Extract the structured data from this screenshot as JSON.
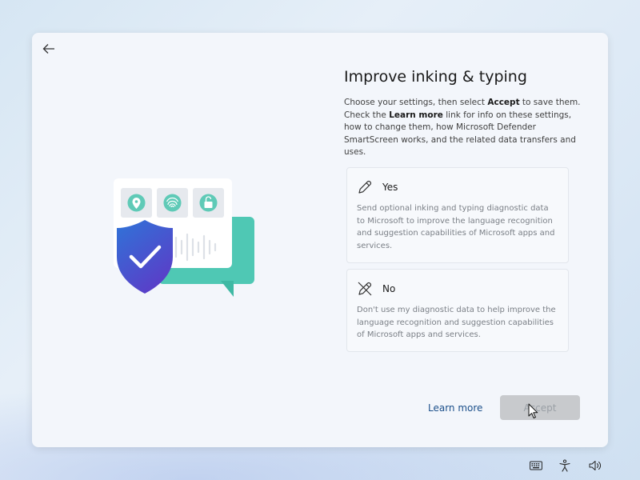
{
  "page": {
    "title": "Improve inking & typing",
    "description": {
      "p1": "Choose your settings, then select ",
      "accept_word": "Accept",
      "p2": " to save them. Check the ",
      "learn_word": "Learn more",
      "p3": " link for info on these settings, how to change them, how Microsoft Defender SmartScreen works, and the related data transfers and uses."
    }
  },
  "options": [
    {
      "label": "Yes",
      "icon": "pen-icon",
      "description": "Send optional inking and typing diagnostic data to Microsoft to improve the language recognition and suggestion capabilities of Microsoft apps and services."
    },
    {
      "label": "No",
      "icon": "pen-off-icon",
      "description": "Don't use my diagnostic data to help improve the language recognition and suggestion capabilities of Microsoft apps and services."
    }
  ],
  "footer": {
    "learn_more": "Learn more",
    "accept": "Accept"
  },
  "tray_icons": [
    "keyboard-icon",
    "accessibility-icon",
    "volume-icon"
  ],
  "colors": {
    "link": "#1b4f8a",
    "shield": "#3d5bd9",
    "bubble": "#4fc8b4",
    "accept_disabled": "#c8cacd"
  }
}
